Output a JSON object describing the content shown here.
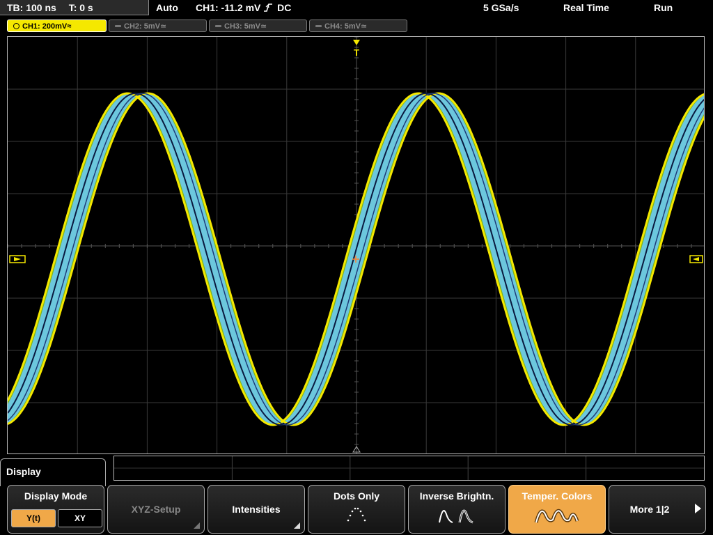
{
  "status": {
    "timebase": "TB: 100 ns",
    "trigger_time": "T: 0 s",
    "acq_mode": "Auto",
    "trigger_info": "CH1: -11.2 mV",
    "coupling": "DC",
    "sample_rate": "5 GSa/s",
    "realtime": "Real Time",
    "run_state": "Run"
  },
  "channels": [
    {
      "label": "CH1: 200mV",
      "coupling_symbol": "≈",
      "active": true
    },
    {
      "label": "CH2: 5mV",
      "coupling_symbol": "≃",
      "active": false
    },
    {
      "label": "CH3: 5mV",
      "coupling_symbol": "≃",
      "active": false
    },
    {
      "label": "CH4: 5mV",
      "coupling_symbol": "≃",
      "active": false
    }
  ],
  "trigger_marker": "T",
  "menu": {
    "title": "Display",
    "display_mode": {
      "label": "Display Mode",
      "options": [
        "Y(t)",
        "XY"
      ],
      "selected": "Y(t)"
    },
    "xyz_setup": "XYZ-Setup",
    "intensities": "Intensities",
    "dots_only": "Dots Only",
    "inverse_brightness": "Inverse Brightn.",
    "temper_colors": "Temper. Colors",
    "more": "More 1|2"
  },
  "colors": {
    "ch1": "#f5e800",
    "accent_orange": "#f0a848",
    "trace_blue": "#6bc8e8",
    "trace_dark": "#0a1a40",
    "trace_green": "#8cc820"
  }
}
